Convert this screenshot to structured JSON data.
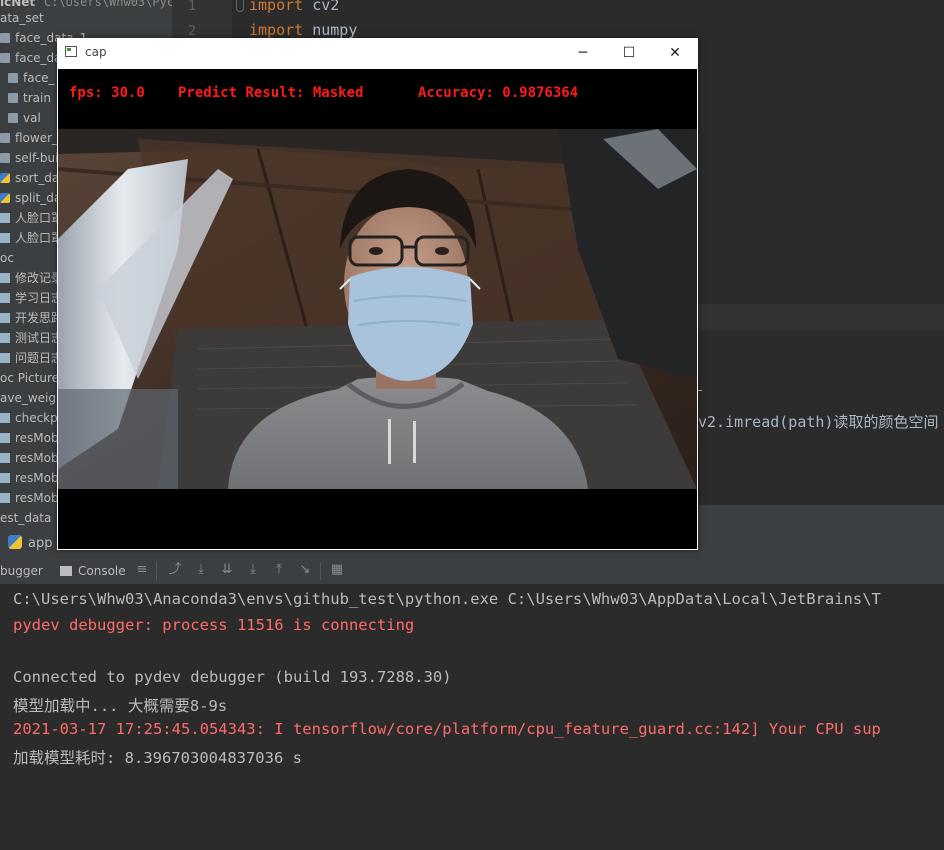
{
  "project_tree": {
    "title": "icNet",
    "path": "C:\\Users\\Whw03\\Pych",
    "items": [
      {
        "label": "ata_set",
        "icon": "none"
      },
      {
        "label": "face_data_1",
        "icon": "folder"
      },
      {
        "label": "face_data",
        "icon": "folder"
      },
      {
        "label": "face_",
        "icon": "folder"
      },
      {
        "label": "train",
        "icon": "folder"
      },
      {
        "label": "val",
        "icon": "folder"
      },
      {
        "label": "flower_d",
        "icon": "folder"
      },
      {
        "label": "self-built",
        "icon": "folder"
      },
      {
        "label": "sort_dat",
        "icon": "py"
      },
      {
        "label": "split_dat",
        "icon": "py"
      },
      {
        "label": "人脸口罩",
        "icon": "file"
      },
      {
        "label": "人脸口罩",
        "icon": "file"
      },
      {
        "label": "oc",
        "icon": "none"
      },
      {
        "label": "修改记录",
        "icon": "file"
      },
      {
        "label": "学习日志",
        "icon": "file"
      },
      {
        "label": "开发思路",
        "icon": "file"
      },
      {
        "label": "测试日志",
        "icon": "file"
      },
      {
        "label": "问题日志",
        "icon": "file"
      },
      {
        "label": "oc Picture",
        "icon": "none"
      },
      {
        "label": "ave_weigh",
        "icon": "none"
      },
      {
        "label": "checkpo",
        "icon": "file"
      },
      {
        "label": "resMobi",
        "icon": "file"
      },
      {
        "label": "resMobi",
        "icon": "file"
      },
      {
        "label": "resMobi",
        "icon": "file"
      },
      {
        "label": "resMobi",
        "icon": "file"
      },
      {
        "label": "est_data",
        "icon": "none"
      }
    ]
  },
  "editor": {
    "line_numbers": [
      "1",
      "2"
    ],
    "line1_kw": "import",
    "line1_rest": " cv2",
    "line2_kw": "import",
    "line2_rest": " numpy",
    "comment_fragment": "v2.imread(path)读取的颜色空间"
  },
  "run_panel": {
    "tab_label": "app",
    "debugger_tab": "bugger",
    "console_tab": "Console"
  },
  "console": {
    "lines": [
      {
        "text": "C:\\Users\\Whw03\\Anaconda3\\envs\\github_test\\python.exe C:\\Users\\Whw03\\AppData\\Local\\JetBrains\\T",
        "style": "normal"
      },
      {
        "text": "pydev debugger: process 11516 is connecting",
        "style": "err"
      },
      {
        "text": "",
        "style": "normal"
      },
      {
        "text": "Connected to pydev debugger (build 193.7288.30)",
        "style": "normal"
      },
      {
        "text": "模型加载中... 大概需要8-9s",
        "style": "normal"
      },
      {
        "text": "2021-03-17 17:25:45.054343: I tensorflow/core/platform/cpu_feature_guard.cc:142] Your CPU sup",
        "style": "err"
      },
      {
        "text": "加载模型耗时:  8.396703004837036 s",
        "style": "normal"
      }
    ]
  },
  "cap_window": {
    "title": "cap",
    "fps_text": "fps: 30.0",
    "predict_text": "Predict Result: Masked",
    "accuracy_text": "Accuracy: 0.9876364",
    "overlay_color": "#ff1a1a"
  }
}
